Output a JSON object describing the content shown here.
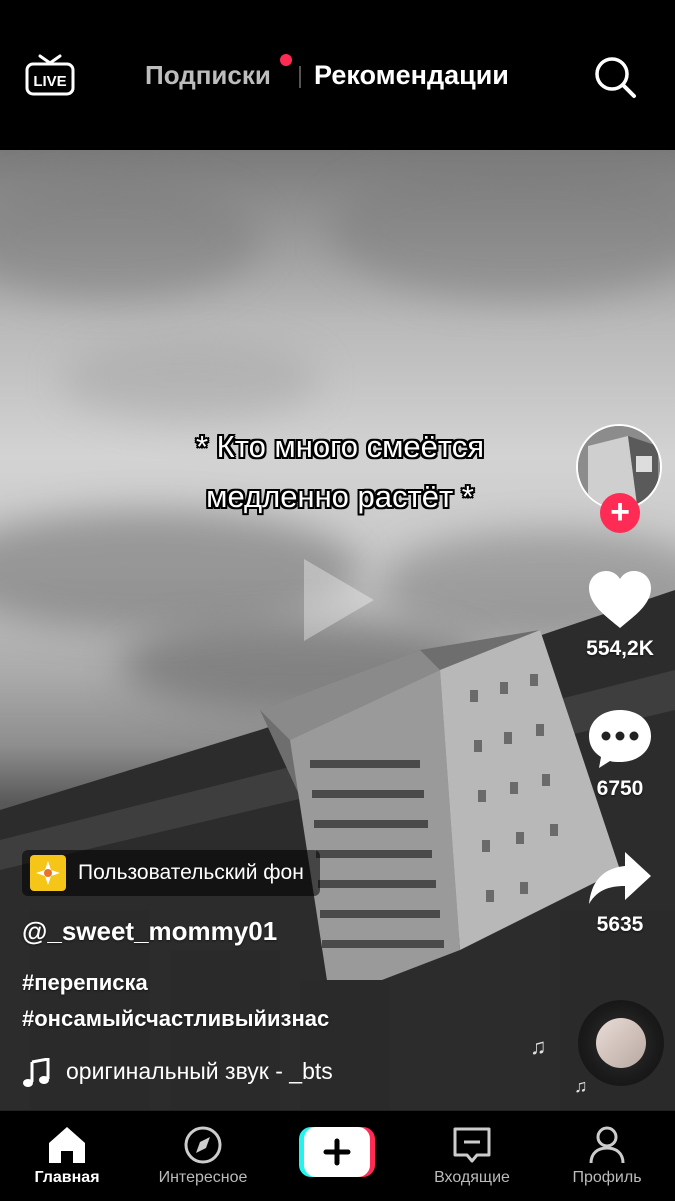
{
  "header": {
    "tab_following": "Подписки",
    "tab_for_you": "Рекомендации"
  },
  "video": {
    "overlay_line1": "* Кто много смеётся",
    "overlay_line2": "медленно растёт *"
  },
  "actions": {
    "likes": "554,2K",
    "comments": "6750",
    "shares": "5635"
  },
  "post": {
    "effect_label": "Пользовательский фон",
    "username": "@_sweet_mommy01",
    "hashtag1": "#переписка",
    "hashtag2": "#онсамыйсчастливыйизнас",
    "music": "оригинальный звук - _bts"
  },
  "nav": {
    "home": "Главная",
    "discover": "Интересное",
    "inbox": "Входящие",
    "profile": "Профиль"
  },
  "colors": {
    "accent": "#fe2c55",
    "chip_icon": "#f5c518",
    "create_left": "#25f4ee",
    "create_right": "#fe2c55"
  }
}
